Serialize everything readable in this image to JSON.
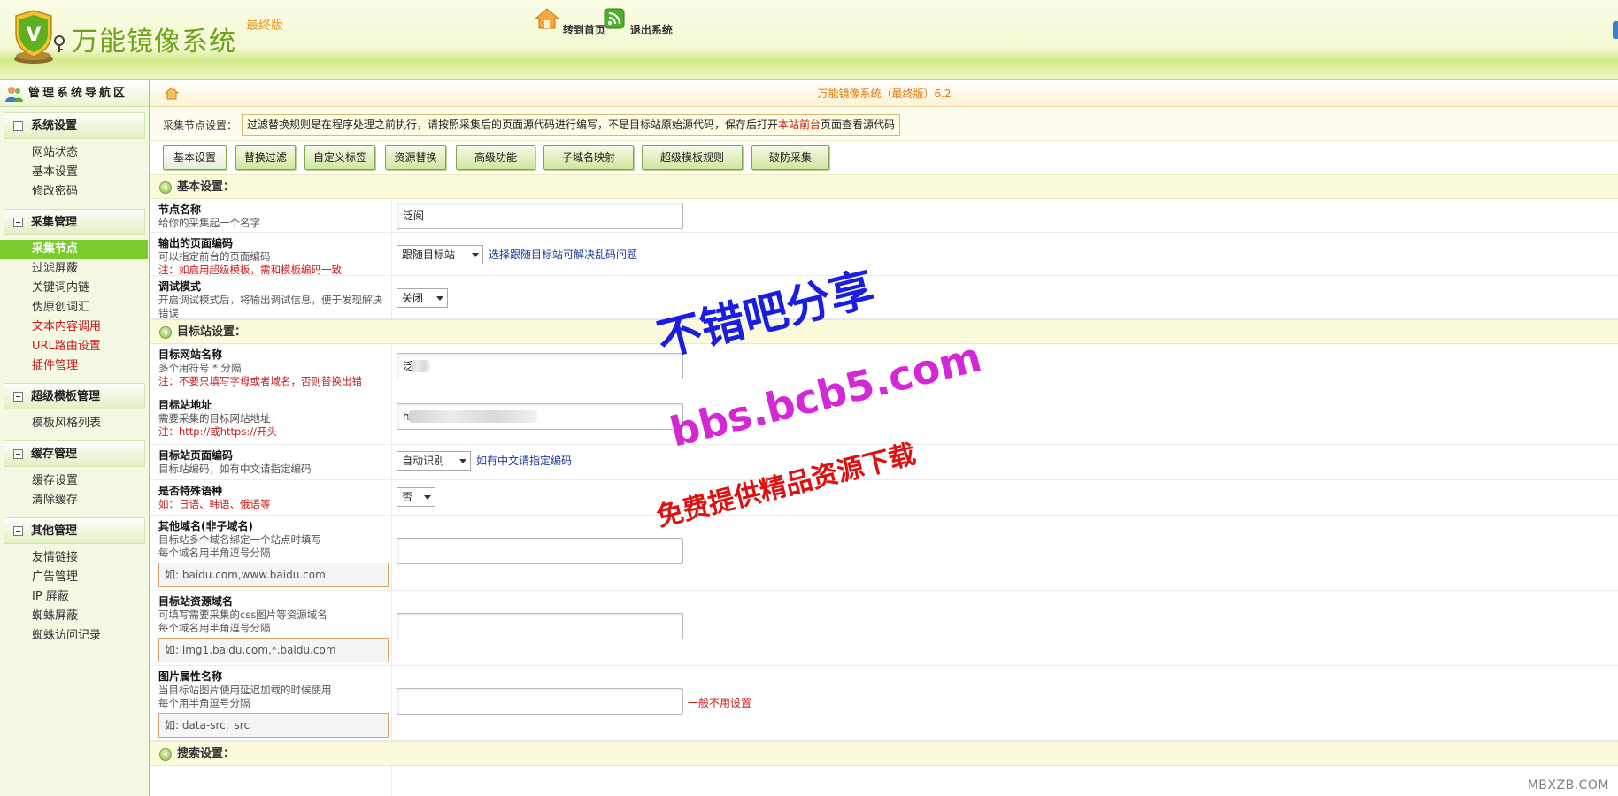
{
  "app": {
    "title": "万能镜像系统",
    "edition": "最终版",
    "logo_letter": "V"
  },
  "topnav": {
    "home_label": "转到首页",
    "exit_label": "退出系统"
  },
  "sidebar": {
    "title": "管理系统导航区",
    "groups": [
      {
        "label": "系统设置",
        "items": [
          "网站状态",
          "基本设置",
          "修改密码"
        ]
      },
      {
        "label": "采集管理",
        "items": [
          "采集节点",
          "过滤屏蔽",
          "关键词内链",
          "伪原创词汇",
          "文本内容调用",
          "URL路由设置",
          "插件管理"
        ]
      },
      {
        "label": "超级模板管理",
        "items": [
          "模板风格列表"
        ]
      },
      {
        "label": "缓存管理",
        "items": [
          "缓存设置",
          "清除缓存"
        ]
      },
      {
        "label": "其他管理",
        "items": [
          "友情链接",
          "广告管理",
          "IP 屏蔽",
          "蜘蛛屏蔽",
          "蜘蛛访问记录"
        ]
      }
    ]
  },
  "main": {
    "page_title": "万能镜像系统（最终版）6.2",
    "notice_label": "采集节点设置：",
    "notice_text_1": "过滤替换规则是在程序处理之前执行，请按照采集后的页面源代码进行编写，不是目标站原始源代码，保存后打开",
    "notice_highlight": "本站前台",
    "notice_text_2": "页面查看源代码",
    "tabs": [
      "基本设置",
      "替换过滤",
      "自定义标签",
      "资源替换",
      "高级功能",
      "子域名映射",
      "超级模板规则",
      "破防采集"
    ],
    "sections": {
      "basic": "基本设置：",
      "target": "目标站设置：",
      "search": "搜索设置："
    },
    "fields": {
      "node_name": {
        "title": "节点名称",
        "desc": "给你的采集起一个名字",
        "value": "泛阅"
      },
      "output_encoding": {
        "title": "输出的页面编码",
        "desc": "可以指定前台的页面编码",
        "note": "注：如启用超级模板，需和模板编码一致",
        "value": "跟随目标站",
        "hint": "选择跟随目标站可解决乱码问题"
      },
      "debug": {
        "title": "调试模式",
        "desc": "开启调试模式后，将输出调试信息，便于发现解决错误",
        "value": "关闭"
      },
      "target_name": {
        "title": "目标网站名称",
        "desc": "多个用符号 * 分隔",
        "note": "注：不要只填写字母或者域名，否则替换出错",
        "value": "泛"
      },
      "target_url": {
        "title": "目标站地址",
        "desc": "需要采集的目标网站地址",
        "note": "注：http://或https://开头",
        "value": "h"
      },
      "target_encoding": {
        "title": "目标站页面编码",
        "desc": "目标站编码，如有中文请指定编码",
        "value": "自动识别",
        "hint": "如有中文请指定编码"
      },
      "special_lang": {
        "title": "是否特殊语种",
        "note": "如：日语、韩语、俄语等",
        "value": "否"
      },
      "other_domains": {
        "title": "其他域名(非子域名)",
        "desc1": "目标站多个域名绑定一个站点时填写",
        "desc2": "每个域名用半角逗号分隔",
        "example": "如: baidu.com,www.baidu.com",
        "value": ""
      },
      "resource_domains": {
        "title": "目标站资源域名",
        "desc1": "可填写需要采集的css图片等资源域名",
        "desc2": "每个域名用半角逗号分隔",
        "example": "如: img1.baidu.com,*.baidu.com",
        "value": ""
      },
      "img_attr": {
        "title": "图片属性名称",
        "desc1": "当目标站图片使用延迟加载的时候使用",
        "desc2": "每个用半角逗号分隔",
        "example": "如: data-src,_src",
        "value": "",
        "hint": "一般不用设置"
      }
    }
  },
  "watermark": {
    "line1": "不错吧分享",
    "line2": "bbs.bcb5.com",
    "line3": "免费提供精品资源下载",
    "corner": "MBXZB.COM"
  },
  "colors": {
    "brand_green": "#6aa31a",
    "active_menu": "#7acb2b",
    "title_orange": "#e1780d",
    "note_red": "#c91d1d",
    "hint_blue": "#1b3a9c",
    "watermark_blue": "#1a1ee0",
    "watermark_magenta": "#d428d6",
    "watermark_red": "#e01010"
  }
}
